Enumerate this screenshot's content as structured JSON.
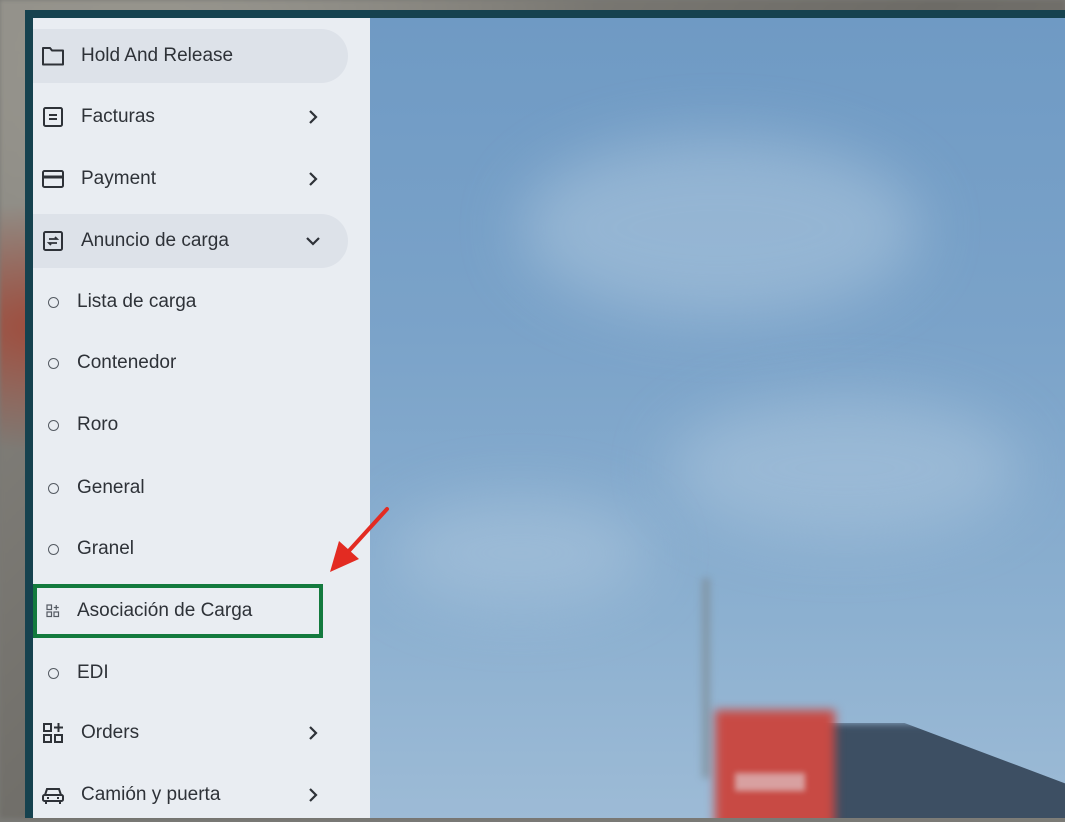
{
  "sidebar": {
    "items": [
      {
        "label": "Hold And Release",
        "icon": "folder-icon",
        "chevron": "",
        "highlight": true
      },
      {
        "label": "Facturas",
        "icon": "invoice-icon",
        "chevron": "right"
      },
      {
        "label": "Payment",
        "icon": "credit-card-icon",
        "chevron": "right"
      },
      {
        "label": "Anuncio de carga",
        "icon": "transfer-icon",
        "chevron": "down",
        "highlight": true
      },
      {
        "label": "Lista de carga",
        "icon": "circle-icon",
        "sub": true
      },
      {
        "label": "Contenedor",
        "icon": "circle-icon",
        "sub": true
      },
      {
        "label": "Roro",
        "icon": "circle-icon",
        "sub": true
      },
      {
        "label": "General",
        "icon": "circle-icon",
        "sub": true
      },
      {
        "label": "Granel",
        "icon": "circle-icon",
        "sub": true
      },
      {
        "label": "Asociación de Carga",
        "icon": "association-icon",
        "sub": true,
        "callout": true
      },
      {
        "label": "EDI",
        "icon": "circle-icon",
        "sub": true
      },
      {
        "label": "Orders",
        "icon": "grid-plus-icon",
        "chevron": "right"
      },
      {
        "label": "Camión y puerta",
        "icon": "truck-icon",
        "chevron": "right"
      }
    ]
  },
  "annotation": {
    "arrow_color": "#e32b22",
    "box_color": "#137a3e"
  }
}
